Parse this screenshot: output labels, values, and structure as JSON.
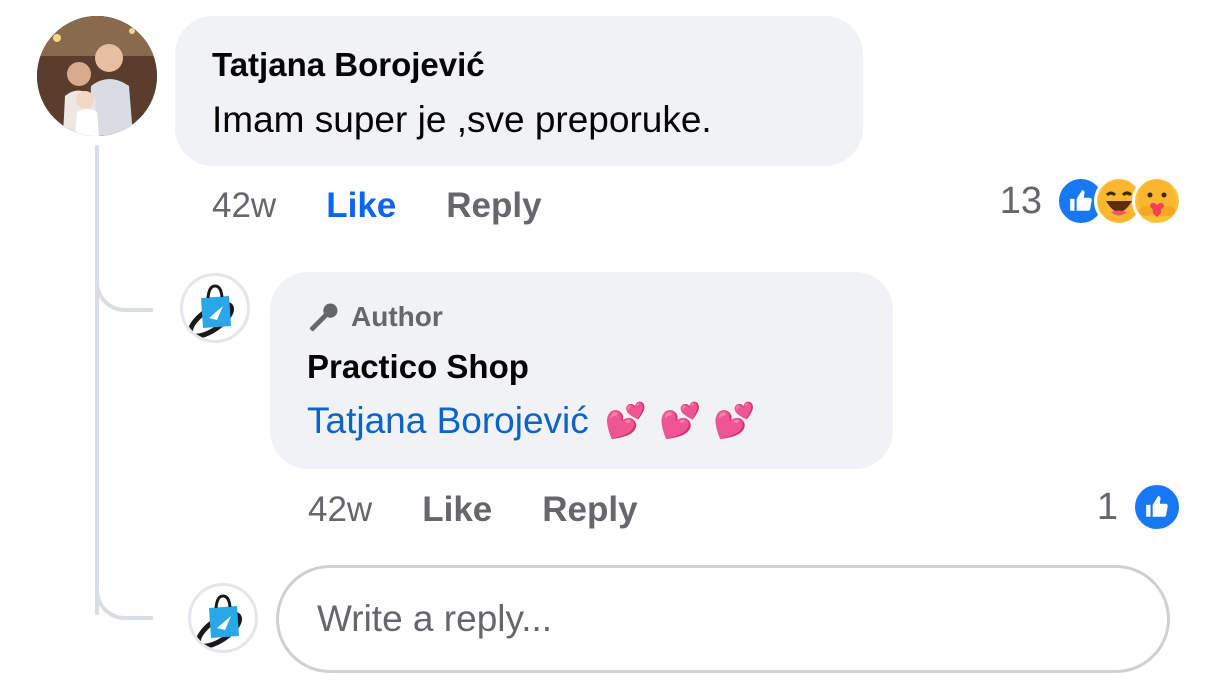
{
  "comment": {
    "author": "Tatjana Borojević",
    "text": "Imam super je ,sve preporuke.",
    "time": "42w",
    "like_label": "Like",
    "reply_label": "Reply",
    "reaction_count": "13",
    "reactions": [
      "like-icon",
      "haha-icon",
      "care-icon"
    ]
  },
  "reply": {
    "badge": "Author",
    "author": "Practico Shop",
    "mention": "Tatjana Borojević",
    "hearts": "💕💕💕",
    "time": "42w",
    "like_label": "Like",
    "reply_label": "Reply",
    "reaction_count": "1",
    "reactions": [
      "like-icon"
    ]
  },
  "composer": {
    "placeholder": "Write a reply..."
  },
  "colors": {
    "like_blue": "#0a66f0",
    "mention_blue": "#0a64c9",
    "muted": "#65676b",
    "bubble": "#f0f2f5"
  }
}
